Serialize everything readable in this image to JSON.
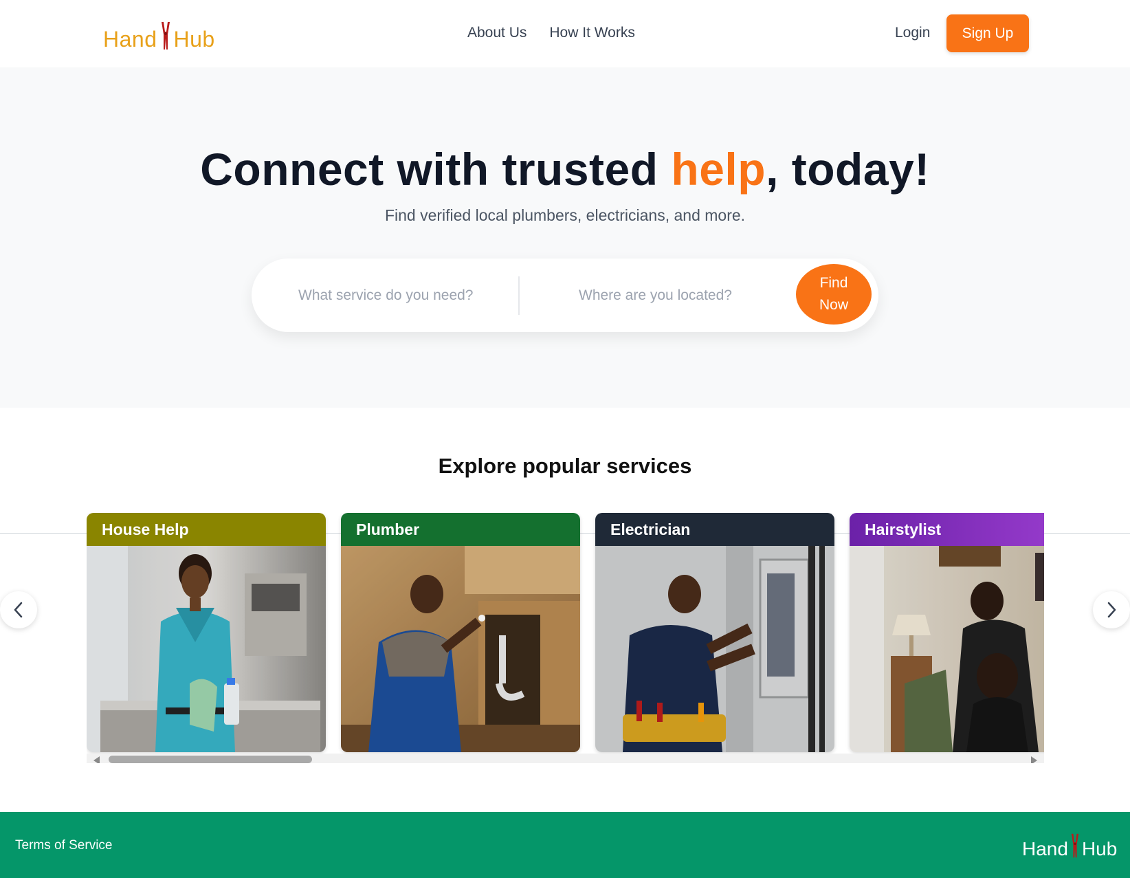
{
  "brand": {
    "name_left": "Hand",
    "name_right": "Hub",
    "color": "#e8a11a",
    "tool_color": "#b91c1c"
  },
  "nav": {
    "items": [
      {
        "label": "About Us"
      },
      {
        "label": "How It Works"
      }
    ],
    "login_label": "Login",
    "signup_label": "Sign Up"
  },
  "hero": {
    "title_before": "Connect with trusted ",
    "title_accent": "help",
    "title_after": ", today!",
    "subtitle": "Find verified local plumbers, electricians, and more.",
    "service_placeholder": "What service do you need?",
    "location_placeholder": "Where are you located?",
    "find_label": "Find Now"
  },
  "services": {
    "title": "Explore popular services",
    "cards": [
      {
        "label": "House Help",
        "band_color": "#8a8500",
        "icon": "house-help-photo"
      },
      {
        "label": "Plumber",
        "band_color": "#14702f",
        "icon": "plumber-photo"
      },
      {
        "label": "Electrician",
        "band_color": "#1f2937",
        "icon": "electrician-photo"
      },
      {
        "label": "Hairstylist",
        "band_color": "#7b2cbf",
        "icon": "hairstylist-photo"
      }
    ]
  },
  "footer": {
    "terms_label": "Terms of Service",
    "logo_left": "Hand",
    "logo_right": "Hub"
  },
  "colors": {
    "accent": "#f97316",
    "footer": "#059669",
    "hero_bg": "#f8f9fa"
  }
}
